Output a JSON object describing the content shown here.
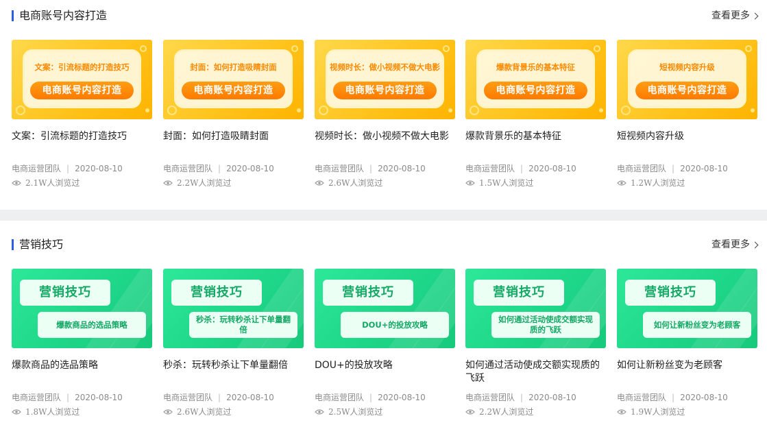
{
  "sections": [
    {
      "title": "电商账号内容打造",
      "more_label": "查看更多",
      "cards": [
        {
          "thumb_title": "文案：引流标题的打造技巧",
          "thumb_pill": "电商账号内容打造",
          "title": "文案：引流标题的打造技巧",
          "author": "电商运营团队",
          "date": "2020-08-10",
          "views": "2.1W人浏览过"
        },
        {
          "thumb_title": "封面：如何打造吸睛封面",
          "thumb_pill": "电商账号内容打造",
          "title": "封面：如何打造吸睛封面",
          "author": "电商运营团队",
          "date": "2020-08-10",
          "views": "2.2W人浏览过"
        },
        {
          "thumb_title": "视频时长：做小视频不做大电影",
          "thumb_pill": "电商账号内容打造",
          "title": "视频时长：做小视频不做大电影",
          "author": "电商运营团队",
          "date": "2020-08-10",
          "views": "2.6W人浏览过"
        },
        {
          "thumb_title": "爆款背景乐的基本特征",
          "thumb_pill": "电商账号内容打造",
          "title": "爆款背景乐的基本特征",
          "author": "电商运营团队",
          "date": "2020-08-10",
          "views": "1.5W人浏览过"
        },
        {
          "thumb_title": "短视频内容升级",
          "thumb_pill": "电商账号内容打造",
          "title": "短视频内容升级",
          "author": "电商运营团队",
          "date": "2020-08-10",
          "views": "1.2W人浏览过"
        }
      ]
    },
    {
      "title": "营销技巧",
      "more_label": "查看更多",
      "cards": [
        {
          "thumb_top": "营销技巧",
          "thumb_bottom": "爆款商品的选品策略",
          "title": "爆款商品的选品策略",
          "author": "电商运营团队",
          "date": "2020-08-10",
          "views": "1.8W人浏览过"
        },
        {
          "thumb_top": "营销技巧",
          "thumb_bottom": "秒杀：玩转秒杀让下单量翻倍",
          "title": "秒杀：玩转秒杀让下单量翻倍",
          "author": "电商运营团队",
          "date": "2020-08-10",
          "views": "2.6W人浏览过"
        },
        {
          "thumb_top": "营销技巧",
          "thumb_bottom": "DOU+的投放攻略",
          "title": "DOU+的投放攻略",
          "author": "电商运营团队",
          "date": "2020-08-10",
          "views": "2.5W人浏览过"
        },
        {
          "thumb_top": "营销技巧",
          "thumb_bottom": "如何通过活动使成交额实现质的飞跃",
          "title": "如何通过活动使成交额实现质的飞跃",
          "author": "电商运营团队",
          "date": "2020-08-10",
          "views": "2.2W人浏览过"
        },
        {
          "thumb_top": "营销技巧",
          "thumb_bottom": "如何让新粉丝变为老顾客",
          "title": "如何让新粉丝变为老顾客",
          "author": "电商运营团队",
          "date": "2020-08-10",
          "views": "1.9W人浏览过"
        }
      ]
    }
  ],
  "icons": {
    "view": "eye-icon",
    "more": "chevron-right-icon"
  },
  "colors": {
    "accent": "#2b5ee6",
    "yellow_bg": "#ffc21a",
    "orange_pill": "#ff7a00",
    "green_bg": "#1fd88a",
    "green_text": "#13a866"
  }
}
